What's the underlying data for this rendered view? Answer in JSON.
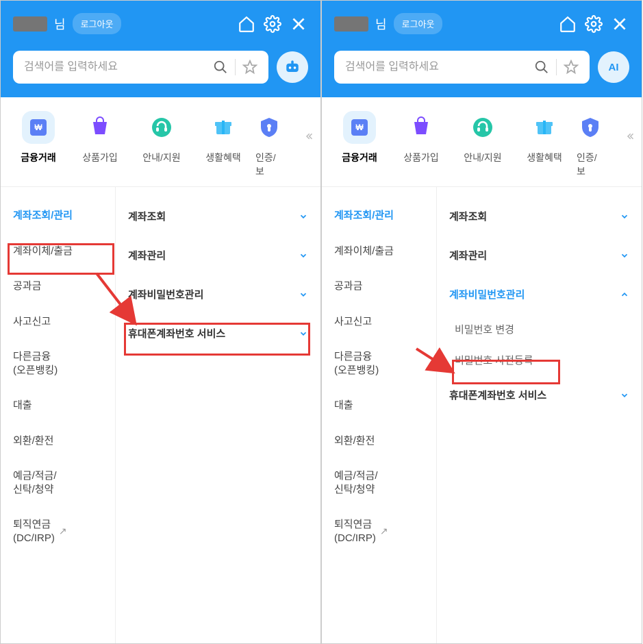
{
  "header": {
    "nim": "님",
    "logout": "로그아웃",
    "search_placeholder": "검색어를 입력하세요",
    "ai_label": "AI"
  },
  "tabs": [
    {
      "label": "금융거래"
    },
    {
      "label": "상품가입"
    },
    {
      "label": "안내/지원"
    },
    {
      "label": "생활혜택"
    },
    {
      "label": "인증/보"
    }
  ],
  "sidebar": [
    {
      "label": "계좌조회/관리"
    },
    {
      "label": "계좌이체/출금"
    },
    {
      "label": "공과금"
    },
    {
      "label": "사고신고"
    },
    {
      "label": "다른금융\n(오픈뱅킹)"
    },
    {
      "label": "대출"
    },
    {
      "label": "외환/환전"
    },
    {
      "label": "예금/적금/\n신탁/청약"
    },
    {
      "label": "퇴직연금\n(DC/IRP)"
    }
  ],
  "content_left": [
    {
      "label": "계좌조회"
    },
    {
      "label": "계좌관리"
    },
    {
      "label": "계좌비밀번호관리"
    },
    {
      "label": "휴대폰계좌번호 서비스"
    }
  ],
  "content_right": [
    {
      "label": "계좌조회"
    },
    {
      "label": "계좌관리"
    },
    {
      "label": "계좌비밀번호관리"
    },
    {
      "label": "휴대폰계좌번호 서비스"
    }
  ],
  "sub_items": [
    {
      "label": "비밀번호 변경"
    },
    {
      "label": "비밀번호 사전등록"
    }
  ]
}
